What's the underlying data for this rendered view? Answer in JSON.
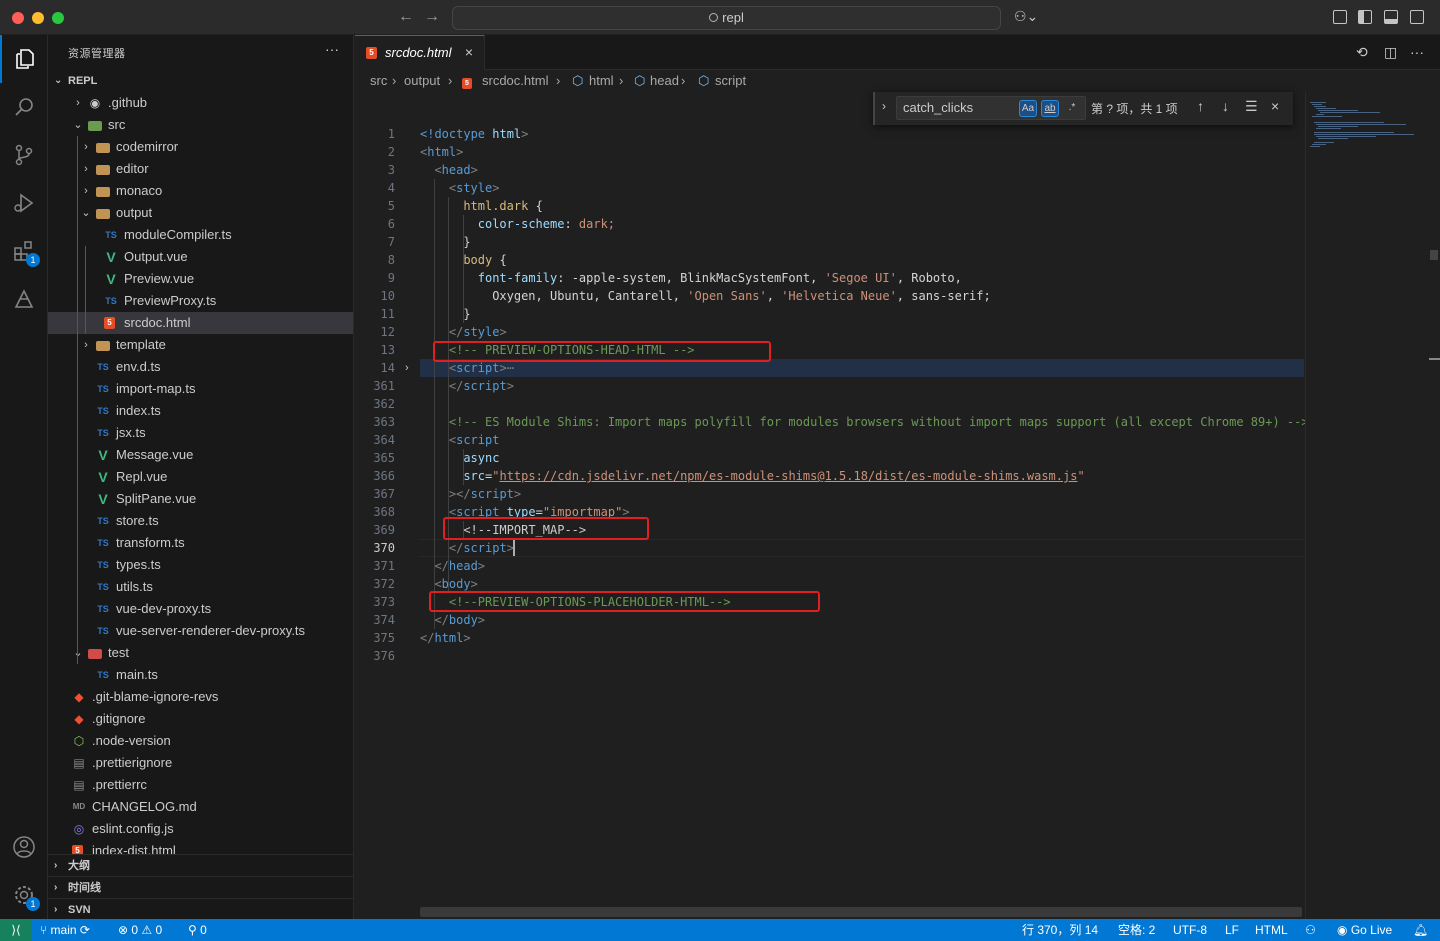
{
  "window": {
    "search": "repl"
  },
  "explorer": {
    "title": "资源管理器",
    "more": "···",
    "root": "REPL",
    "items": [
      {
        "label": ".github",
        "icon": "github-folder-icon",
        "chev": "›"
      },
      {
        "label": "src",
        "icon": "folder-src-icon",
        "chev": "⌄"
      },
      {
        "label": "codemirror",
        "icon": "folder-icon",
        "chev": "›"
      },
      {
        "label": "editor",
        "icon": "folder-icon",
        "chev": "›"
      },
      {
        "label": "monaco",
        "icon": "folder-icon",
        "chev": "›"
      },
      {
        "label": "output",
        "icon": "folder-open-icon",
        "chev": "⌄"
      },
      {
        "label": "moduleCompiler.ts",
        "icon": "ts-file-icon"
      },
      {
        "label": "Output.vue",
        "icon": "vue-file-icon"
      },
      {
        "label": "Preview.vue",
        "icon": "vue-file-icon"
      },
      {
        "label": "PreviewProxy.ts",
        "icon": "ts-file-icon"
      },
      {
        "label": "srcdoc.html",
        "icon": "html-file-icon"
      },
      {
        "label": "template",
        "icon": "folder-icon",
        "chev": "›"
      },
      {
        "label": "env.d.ts",
        "icon": "ts-file-icon"
      },
      {
        "label": "import-map.ts",
        "icon": "ts-file-icon"
      },
      {
        "label": "index.ts",
        "icon": "ts-file-icon"
      },
      {
        "label": "jsx.ts",
        "icon": "ts-file-icon"
      },
      {
        "label": "Message.vue",
        "icon": "vue-file-icon"
      },
      {
        "label": "Repl.vue",
        "icon": "vue-file-icon"
      },
      {
        "label": "SplitPane.vue",
        "icon": "vue-file-icon"
      },
      {
        "label": "store.ts",
        "icon": "ts-file-icon"
      },
      {
        "label": "transform.ts",
        "icon": "ts-file-icon"
      },
      {
        "label": "types.ts",
        "icon": "ts-file-icon"
      },
      {
        "label": "utils.ts",
        "icon": "ts-file-icon"
      },
      {
        "label": "vue-dev-proxy.ts",
        "icon": "ts-file-icon"
      },
      {
        "label": "vue-server-renderer-dev-proxy.ts",
        "icon": "ts-file-icon"
      },
      {
        "label": "test",
        "icon": "folder-test-icon",
        "chev": "⌄"
      },
      {
        "label": "main.ts",
        "icon": "ts-file-icon"
      },
      {
        "label": ".git-blame-ignore-revs",
        "icon": "git-icon"
      },
      {
        "label": ".gitignore",
        "icon": "git-icon"
      },
      {
        "label": ".node-version",
        "icon": "node-icon"
      },
      {
        "label": ".prettierignore",
        "icon": "prettier-icon"
      },
      {
        "label": ".prettierrc",
        "icon": "prettier-icon"
      },
      {
        "label": "CHANGELOG.md",
        "icon": "markdown-icon"
      },
      {
        "label": "eslint.config.js",
        "icon": "eslint-icon"
      },
      {
        "label": "index-dist.html",
        "icon": "html-file-icon"
      }
    ],
    "outline": "大纲",
    "timeline": "时间线",
    "svn": "SVN"
  },
  "activity": {
    "extensions_badge": "1",
    "accounts_badge": "1"
  },
  "tab": {
    "name": "srcdoc.html",
    "close": "×"
  },
  "breadcrumb": {
    "segments": [
      "src",
      "output",
      "srcdoc.html",
      "html",
      "head",
      "script"
    ],
    "sep": "›"
  },
  "find": {
    "query": "catch_clicks",
    "match_case": "Aa",
    "whole_word": "ab",
    "regex": ".*",
    "count": "第 ? 项，共 1 项"
  },
  "code": {
    "lines": [
      {
        "n": "1"
      },
      {
        "n": "2"
      },
      {
        "n": "3"
      },
      {
        "n": "4"
      },
      {
        "n": "5"
      },
      {
        "n": "6"
      },
      {
        "n": "7"
      },
      {
        "n": "8"
      },
      {
        "n": "9"
      },
      {
        "n": "10"
      },
      {
        "n": "11"
      },
      {
        "n": "12"
      },
      {
        "n": "13"
      },
      {
        "n": "14"
      },
      {
        "n": "361"
      },
      {
        "n": "362"
      },
      {
        "n": "363"
      },
      {
        "n": "364"
      },
      {
        "n": "365"
      },
      {
        "n": "366"
      },
      {
        "n": "367"
      },
      {
        "n": "368"
      },
      {
        "n": "369"
      },
      {
        "n": "370"
      },
      {
        "n": "371"
      },
      {
        "n": "372"
      },
      {
        "n": "373"
      },
      {
        "n": "374"
      },
      {
        "n": "375"
      },
      {
        "n": "376"
      }
    ],
    "t": {
      "doctype": "<!doctype",
      "doctype_html": " html",
      "html": "html",
      "head": "head",
      "style": "style",
      "sel_html_dark": "html.dark ",
      "prop_color_scheme": "color-scheme",
      "val_dark": " dark;",
      "sel_body": "body ",
      "prop_font_family": "font-family",
      "val_ff1": " -apple-system, BlinkMacSystemFont, ",
      "str_segoe": "'Segoe UI'",
      "val_ff2": ", Roboto,",
      "val_ff3": "Oxygen, Ubuntu, Cantarell, ",
      "str_open_sans": "'Open Sans'",
      "str_helvetica": "'Helvetica Neue'",
      "val_ff4": ", sans-serif;",
      "comment_head": "<!-- PREVIEW-OPTIONS-HEAD-HTML -->",
      "script": "script",
      "fold_dots": "⋯",
      "comment_shims": "<!-- ES Module Shims: Import maps polyfill for modules browsers without import maps support (all except Chrome 89+) -->",
      "attr_async": "async",
      "attr_src": "src",
      "url_shims": "https://cdn.jsdelivr.net/npm/es-module-shims@1.5.18/dist/es-module-shims.wasm.js",
      "attr_type": "type",
      "str_importmap": "\"importmap\"",
      "import_map_comment": "<!--IMPORT_MAP-->",
      "body": "body",
      "comment_placeholder": "<!--PREVIEW-OPTIONS-PLACEHOLDER-HTML-->"
    }
  },
  "status": {
    "branch": "main",
    "errors": "0",
    "warnings": "0",
    "ports": "0",
    "cursor": "行 370，列 14",
    "spaces": "空格: 2",
    "encoding": "UTF-8",
    "eol": "LF",
    "language": "HTML",
    "golive": "Go Live"
  },
  "colors": {
    "accent": "#0078d4",
    "highlight_box": "#e02020",
    "remote": "#16825d"
  }
}
